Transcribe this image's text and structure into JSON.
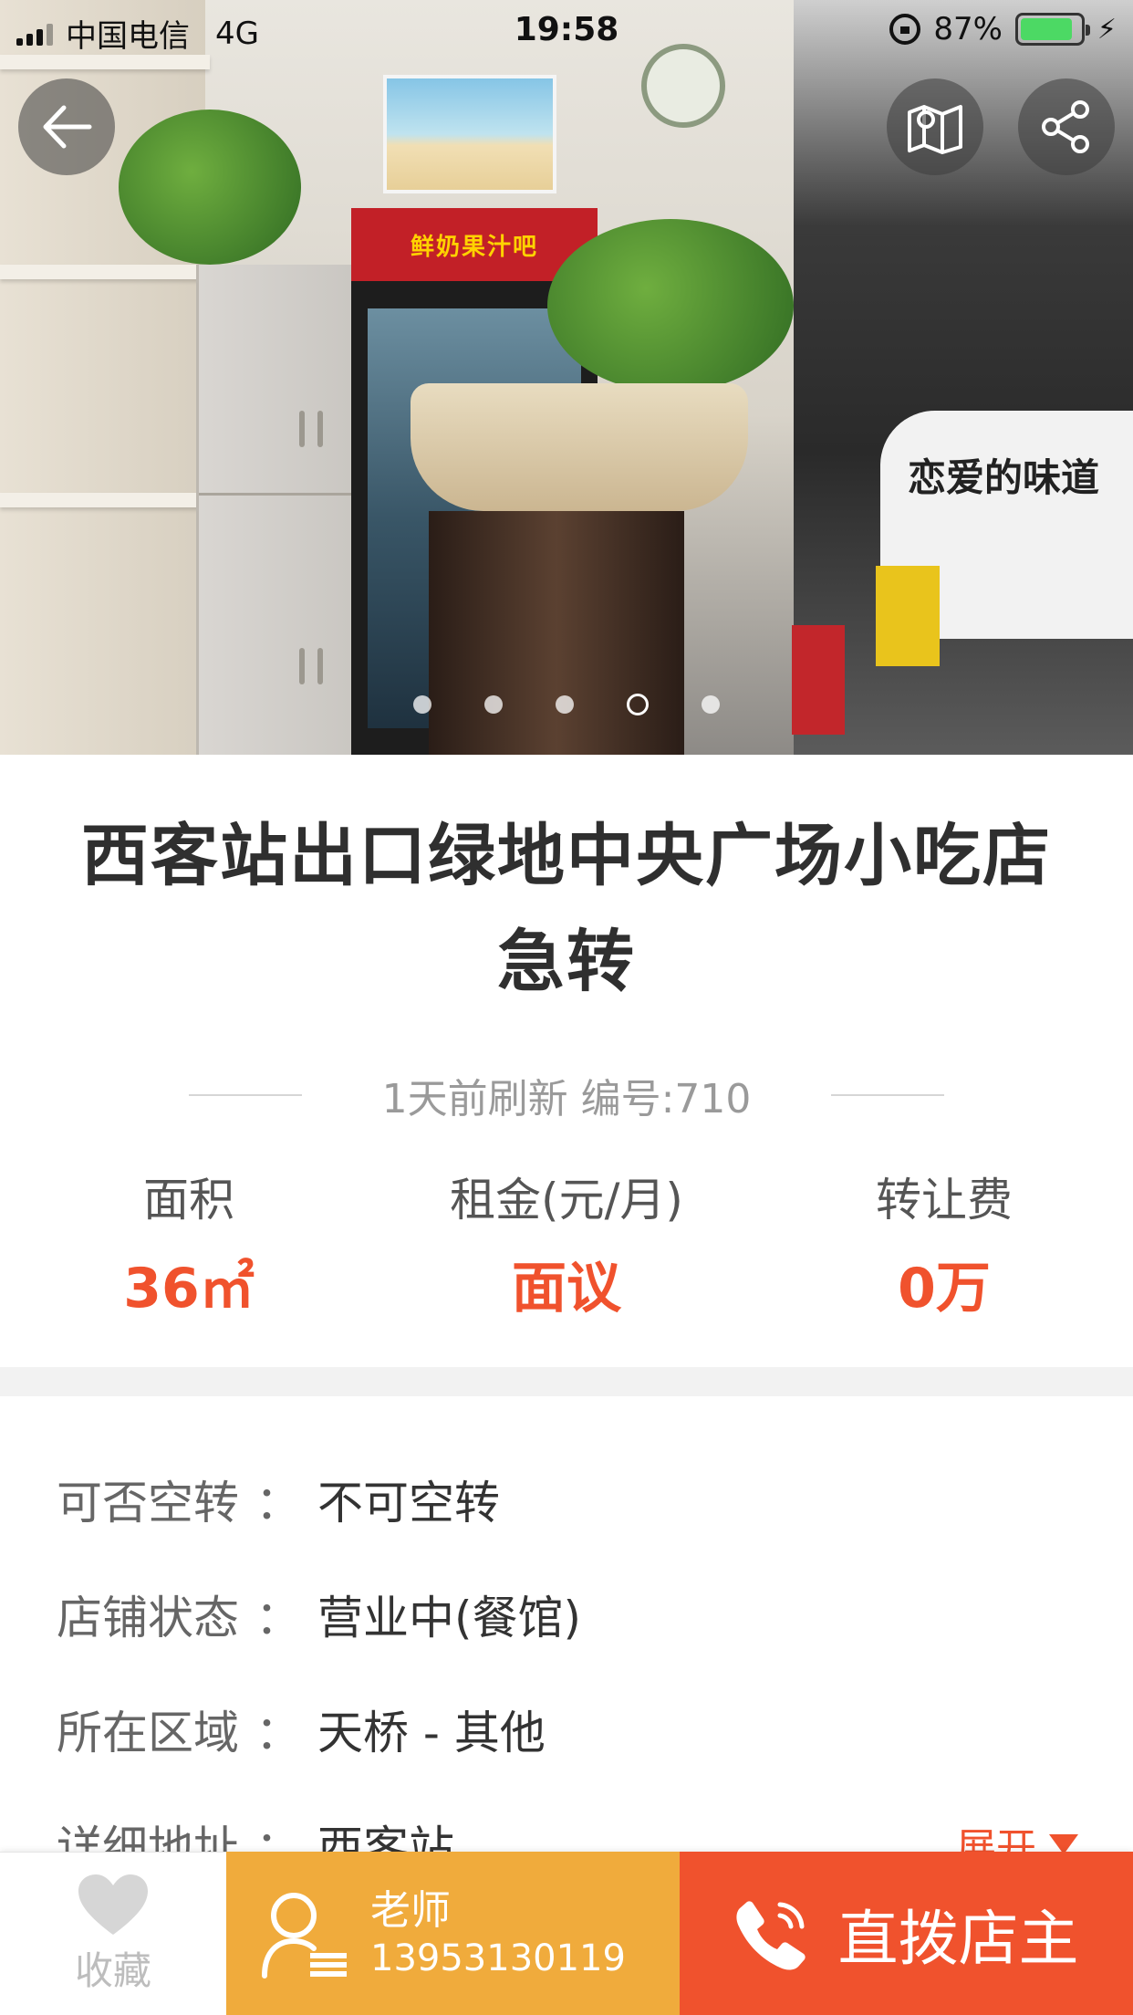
{
  "status_bar": {
    "carrier": "中国电信",
    "network": "4G",
    "time": "19:58",
    "battery": "87%",
    "battery_level": 0.87
  },
  "gallery": {
    "sign_text": "鲜奶果汁吧",
    "counter_text": "恋爱的味道",
    "dot_count": 5,
    "active_index": 3
  },
  "listing": {
    "title": "西客站出口绿地中央广场小吃店急转",
    "meta": "1天前刷新  编号:710",
    "stats": [
      {
        "label": "面积",
        "value": "36㎡"
      },
      {
        "label": "租金(元/月)",
        "value": "面议"
      },
      {
        "label": "转让费",
        "value": "0万"
      }
    ],
    "details": [
      {
        "key": "可否空转",
        "value": "不可空转"
      },
      {
        "key": "店铺状态",
        "value": "营业中(餐馆)"
      },
      {
        "key": "所在区域",
        "value": "天桥 - 其他"
      },
      {
        "key": "详细地址",
        "value": "西客站"
      }
    ],
    "expand_label": "展开",
    "separator": "："
  },
  "bottom_bar": {
    "favorite_label": "收藏",
    "contact_name": "老师",
    "contact_phone": "13953130119",
    "call_label": "直拨店主"
  },
  "colors": {
    "accent": "#f0522d",
    "contact_bg": "#f0ab3c",
    "title": "#2f2f2f"
  },
  "icons": [
    "back-arrow-icon",
    "map-icon",
    "share-icon",
    "heart-icon",
    "person-icon",
    "phone-icon"
  ]
}
